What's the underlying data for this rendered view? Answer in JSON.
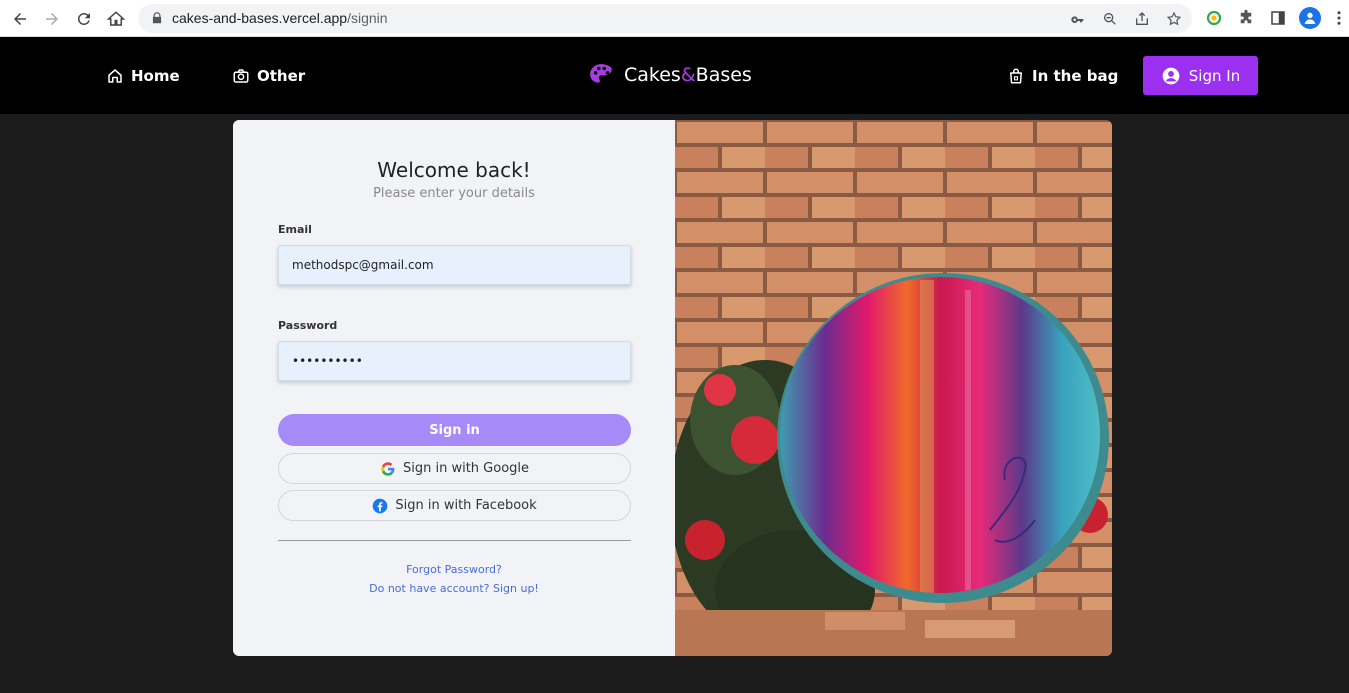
{
  "browser": {
    "url_domain": "cakes-and-bases.vercel.app",
    "url_path": "/signin"
  },
  "nav": {
    "home_label": "Home",
    "other_label": "Other",
    "brand_first": "Cakes",
    "brand_amp": "&",
    "brand_second": "Bases",
    "bag_label": "In the bag",
    "signin_label": "Sign In"
  },
  "form": {
    "title": "Welcome back!",
    "subtitle": "Please enter your details",
    "email_label": "Email",
    "email_value": "methodspc@gmail.com",
    "password_label": "Password",
    "password_value": "••••••••••",
    "signin_button": "Sign in",
    "google_button": "Sign in with Google",
    "facebook_button": "Sign in with Facebook",
    "forgot_link": "Forgot Password?",
    "signup_link": "Do not have account? Sign up!"
  },
  "colors": {
    "brand_purple": "#9b30f0",
    "primary_button": "#a68af7",
    "link": "#4a6cd8"
  }
}
